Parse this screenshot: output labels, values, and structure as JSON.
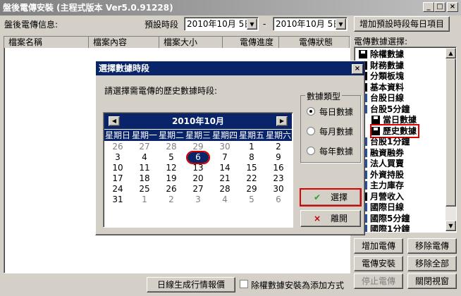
{
  "window": {
    "title": "盤後電傳安裝 (主程式版本 Ver5.0.91228)",
    "min": "_",
    "max": "□",
    "close": "×"
  },
  "toolbar": {
    "info_label": "盤後電傳信息:",
    "period_label": "預設時段",
    "start_date": "2010年10月 5日",
    "dash": "-",
    "end_date": "2010年10月 5日",
    "add_daily_btn": "增加預設時段每日項目"
  },
  "table": {
    "columns": [
      "檔案名稱",
      "檔案內容",
      "檔案大小",
      "電傳進度",
      "電傳狀態"
    ]
  },
  "tree": {
    "label": "電傳數據選擇:",
    "items": [
      {
        "label": "除權數據",
        "icon": "floppy-icon",
        "indent": 0
      },
      {
        "label": "財務數據",
        "icon": "floppy-icon",
        "indent": 0
      },
      {
        "label": "分類板塊",
        "icon": "floppy-icon",
        "indent": 0
      },
      {
        "label": "基本資料",
        "icon": "floppy-icon",
        "indent": 0
      },
      {
        "label": "台股日線",
        "icon": "network-icon",
        "indent": 0
      },
      {
        "label": "台股5分鐘",
        "icon": "network-icon",
        "indent": 0
      },
      {
        "label": "當日數據",
        "icon": "floppy-icon",
        "indent": 1
      },
      {
        "label": "歷史數據",
        "icon": "floppy-icon",
        "indent": 1
      },
      {
        "label": "台股1分鐘",
        "icon": "network-icon",
        "indent": 0
      },
      {
        "label": "融資融券",
        "icon": "network-icon",
        "indent": 0
      },
      {
        "label": "法人買賣",
        "icon": "network-icon",
        "indent": 0
      },
      {
        "label": "外資持股",
        "icon": "network-icon",
        "indent": 0
      },
      {
        "label": "主力庫存",
        "icon": "network-icon",
        "indent": 0
      },
      {
        "label": "月營收入",
        "icon": "floppy-icon",
        "indent": 0
      },
      {
        "label": "國際日線",
        "icon": "network-icon",
        "indent": 0
      },
      {
        "label": "國際5分鐘",
        "icon": "network-icon",
        "indent": 0
      },
      {
        "label": "國際1分鐘",
        "icon": "network-icon",
        "indent": 0
      }
    ]
  },
  "side_buttons": {
    "add": "增加電傳",
    "remove": "移除電傳",
    "install": "電傳安裝",
    "remove_all": "移除全部",
    "stop": "停止電傳",
    "close": "關閉視窗"
  },
  "bottom": {
    "daily_report_btn": "日線生成行情報價",
    "checkbox_label": "除權數據安裝為添加方式"
  },
  "dialog": {
    "title": "選擇數據時段",
    "close": "×",
    "prompt": "請選擇需電傳的歷史數據時段:",
    "calendar": {
      "month_title": "2010年10月",
      "prev": "◀",
      "next": "▶",
      "weekdays": [
        "星期日",
        "星期一",
        "星期二",
        "星期三",
        "星期四",
        "星期五",
        "星期六"
      ],
      "weeks": [
        [
          "26",
          "27",
          "28",
          "29",
          "30",
          "1",
          "2"
        ],
        [
          "3",
          "4",
          "5",
          "6",
          "7",
          "8",
          "9"
        ],
        [
          "10",
          "11",
          "12",
          "13",
          "14",
          "15",
          "16"
        ],
        [
          "17",
          "18",
          "19",
          "20",
          "21",
          "22",
          "23"
        ],
        [
          "24",
          "25",
          "26",
          "27",
          "28",
          "29",
          "30"
        ],
        [
          "31",
          "1",
          "2",
          "3",
          "4",
          "5",
          "6"
        ]
      ],
      "selected": "6"
    },
    "type_group": "數據類型",
    "types": [
      "每日數據",
      "每月數據",
      "每年數據"
    ],
    "selected_type": "每日數據",
    "ok_btn": "選擇",
    "cancel_btn": "離開",
    "close_btn": "×"
  }
}
